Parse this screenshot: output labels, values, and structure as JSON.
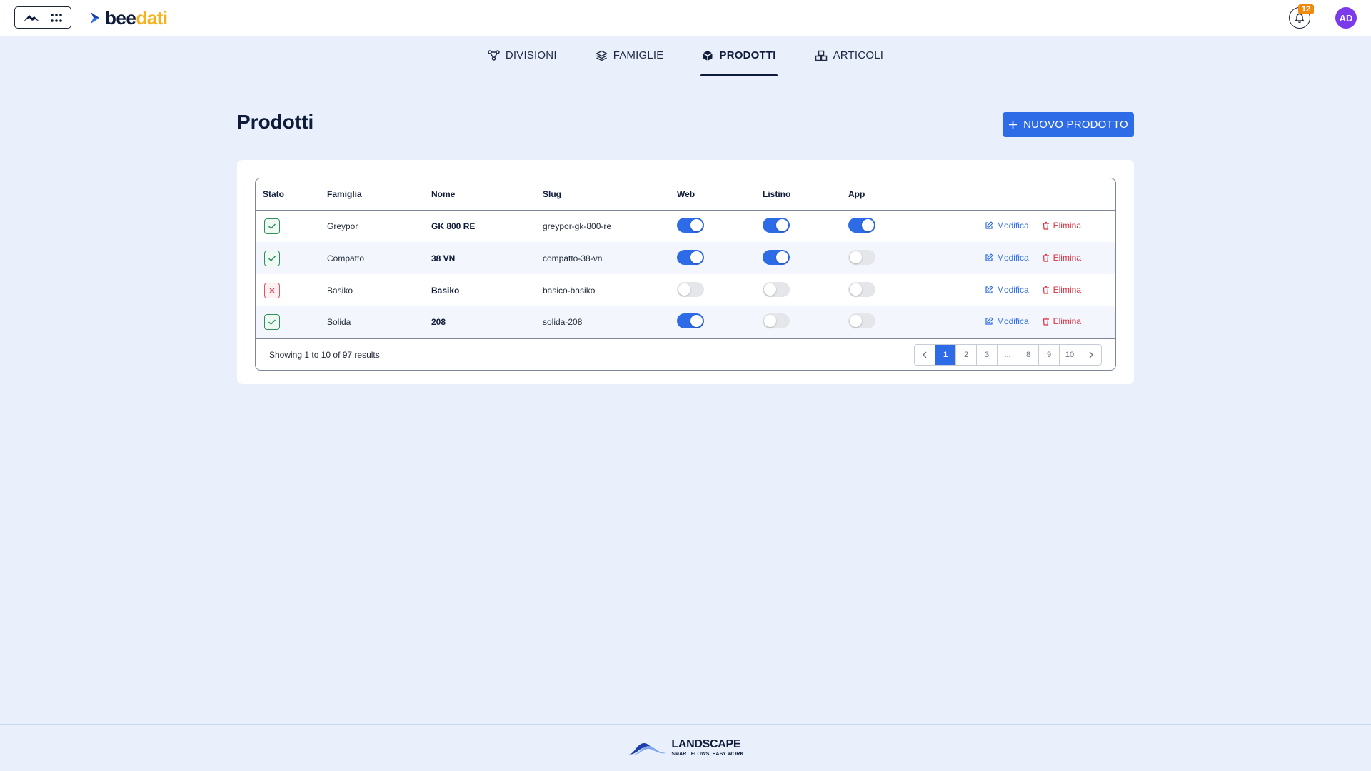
{
  "header": {
    "brand_part1": "bee",
    "brand_part2": "dati",
    "notification_count": "12",
    "avatar_initials": "AD"
  },
  "tabs": [
    {
      "label": "DIVISIONI",
      "icon": "hierarchy-icon",
      "active": false
    },
    {
      "label": "FAMIGLIE",
      "icon": "layers-icon",
      "active": false
    },
    {
      "label": "PRODOTTI",
      "icon": "box-icon",
      "active": true
    },
    {
      "label": "ARTICOLI",
      "icon": "boxes-icon",
      "active": false
    }
  ],
  "page": {
    "title": "Prodotti",
    "new_button_label": "NUOVO PRODOTTO"
  },
  "table": {
    "columns": [
      "Stato",
      "Famiglia",
      "Nome",
      "Slug",
      "Web",
      "Listino",
      "App"
    ],
    "rows": [
      {
        "stato": "active",
        "famiglia": "Greypor",
        "nome": "GK 800 RE",
        "slug": "greypor-gk-800-re",
        "web": true,
        "listino": true,
        "app": true,
        "edit": "Modifica",
        "delete": "Elimina"
      },
      {
        "stato": "active",
        "famiglia": "Compatto",
        "nome": "38 VN",
        "slug": "compatto-38-vn",
        "web": true,
        "listino": true,
        "app": false,
        "edit": "Modifica",
        "delete": "Elimina"
      },
      {
        "stato": "inactive",
        "famiglia": "Basiko",
        "nome": "Basiko",
        "slug": "basico-basiko",
        "web": false,
        "listino": false,
        "app": false,
        "edit": "Modifica",
        "delete": "Elimina"
      },
      {
        "stato": "active",
        "famiglia": "Solida",
        "nome": "208",
        "slug": "solida-208",
        "web": true,
        "listino": false,
        "app": false,
        "edit": "Modifica",
        "delete": "Elimina"
      }
    ],
    "showing_text": "Showing 1 to 10 of 97 results",
    "pagination": [
      "1",
      "2",
      "3",
      "...",
      "8",
      "9",
      "10"
    ],
    "current_page": "1"
  },
  "footer": {
    "brand": "LANDSCAPE",
    "tagline": "SMART FLOWS, EASY WORK"
  },
  "colors": {
    "accent": "#2e6be6",
    "background": "#e9f0fc",
    "danger": "#e0303f",
    "success": "#2f8f5b",
    "badge": "#f08a0f",
    "avatar": "#7c3aed"
  }
}
